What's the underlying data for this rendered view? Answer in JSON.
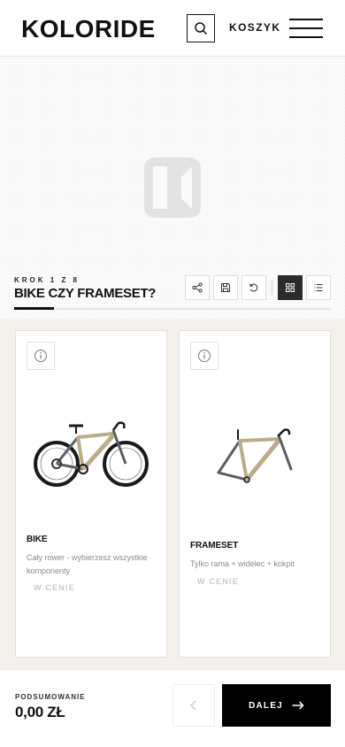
{
  "header": {
    "logo_text": "KOLORIDE",
    "cart_label": "KOSZYK"
  },
  "step": {
    "counter": "KROK 1 Z 8",
    "title": "BIKE CZY FRAMESET?",
    "progress": 0.125
  },
  "options": [
    {
      "title": "BIKE",
      "description": "Cały rower - wybierzesz wszystkie komponenty",
      "price": "W CENIE",
      "frame_color": "#b9ac86",
      "tube_color": "#5b5f63"
    },
    {
      "title": "FRAMESET",
      "description": "Tylko rama + widelec + kokpit",
      "price": "W CENIE",
      "frame_color": "#b9ac86",
      "tube_color": "#5b5f63"
    }
  ],
  "footer": {
    "summary_label": "PODSUMOWANIE",
    "summary_value": "0,00 ZŁ",
    "next_label": "DALEJ"
  },
  "colors": {
    "accent": "#000000",
    "card_background": "#f4f1ec",
    "muted": "#8a8a8a"
  },
  "icons": [
    "search-icon",
    "menu-icon",
    "share-icon",
    "save-icon",
    "reset-icon",
    "grid-view-icon",
    "list-view-icon",
    "info-icon",
    "chevron-left-icon",
    "arrow-right-icon"
  ]
}
